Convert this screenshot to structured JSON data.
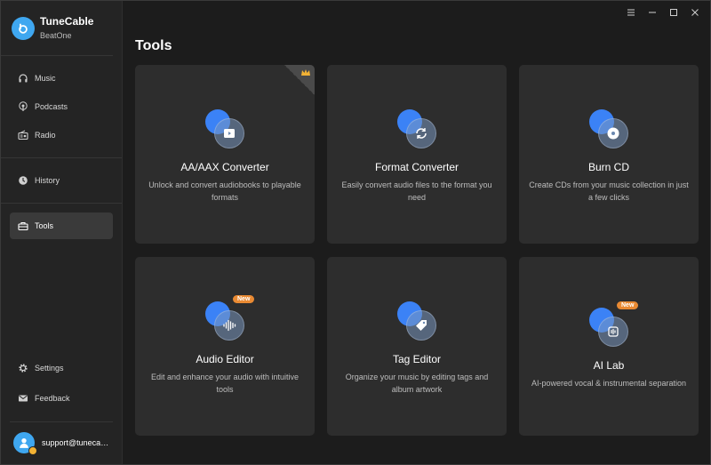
{
  "app": {
    "name": "TuneCable",
    "subtitle": "BeatOne"
  },
  "sidebar": {
    "groups": [
      [
        {
          "label": "Music",
          "icon": "headphones-icon"
        },
        {
          "label": "Podcasts",
          "icon": "podcast-icon"
        },
        {
          "label": "Radio",
          "icon": "radio-icon"
        }
      ],
      [
        {
          "label": "History",
          "icon": "history-icon"
        }
      ],
      [
        {
          "label": "Tools",
          "icon": "toolbox-icon",
          "active": true
        }
      ]
    ],
    "bottom": [
      {
        "label": "Settings",
        "icon": "gear-icon"
      },
      {
        "label": "Feedback",
        "icon": "mail-icon"
      }
    ],
    "account": {
      "email": "support@tunecable.com"
    }
  },
  "main": {
    "title": "Tools",
    "cards": [
      {
        "title": "AA/AAX Converter",
        "desc": "Unlock and convert audiobooks to playable formats",
        "icon": "audiobook-icon",
        "badge": "",
        "corner": true
      },
      {
        "title": "Format Converter",
        "desc": "Easily convert audio files to the format you need",
        "icon": "convert-icon",
        "badge": ""
      },
      {
        "title": "Burn CD",
        "desc": "Create CDs from your music collection in just a few clicks",
        "icon": "cd-icon",
        "badge": ""
      },
      {
        "title": "Audio Editor",
        "desc": "Edit and enhance your audio with intuitive tools",
        "icon": "waveform-icon",
        "badge": "New"
      },
      {
        "title": "Tag Editor",
        "desc": "Organize your music by editing tags and album artwork",
        "icon": "tag-icon",
        "badge": ""
      },
      {
        "title": "AI Lab",
        "desc": "AI-powered vocal & instrumental separation",
        "icon": "ai-icon",
        "badge": "New"
      }
    ]
  },
  "colors": {
    "accent": "#3fa7f0",
    "badge": "#e98a33",
    "card": "#2d2d2d",
    "sidebar": "#242424",
    "background": "#1c1c1c"
  }
}
